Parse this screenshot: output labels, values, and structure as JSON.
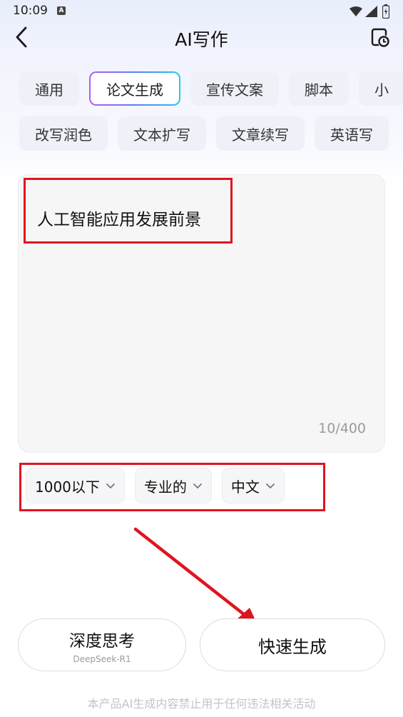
{
  "status_bar": {
    "time": "10:09",
    "notification_icon": "A"
  },
  "header": {
    "title": "AI写作",
    "back_icon": "chevron-left-icon",
    "history_icon": "document-clock-icon"
  },
  "tabs": {
    "row1": [
      {
        "label": "通用",
        "active": false
      },
      {
        "label": "论文生成",
        "active": true
      },
      {
        "label": "宣传文案",
        "active": false
      },
      {
        "label": "脚本",
        "active": false
      },
      {
        "label": "小",
        "active": false
      }
    ],
    "row2": [
      {
        "label": "改写润色"
      },
      {
        "label": "文本扩写"
      },
      {
        "label": "文章续写"
      },
      {
        "label": "英语写"
      }
    ]
  },
  "input": {
    "value": "人工智能应用发展前景",
    "char_count": "10/400"
  },
  "options": [
    {
      "label": "1000以下"
    },
    {
      "label": "专业的"
    },
    {
      "label": "中文"
    }
  ],
  "buttons": {
    "deep_think": {
      "label": "深度思考",
      "sub": "DeepSeek-R1"
    },
    "fast_generate": {
      "label": "快速生成"
    }
  },
  "disclaimer": "本产品AI生成内容禁止用于任何违法相关活动",
  "colors": {
    "highlight": "#e0141f",
    "tab_bg": "#eef1f8",
    "gradient_start": "#b55cf0",
    "gradient_end": "#29c7e8"
  }
}
